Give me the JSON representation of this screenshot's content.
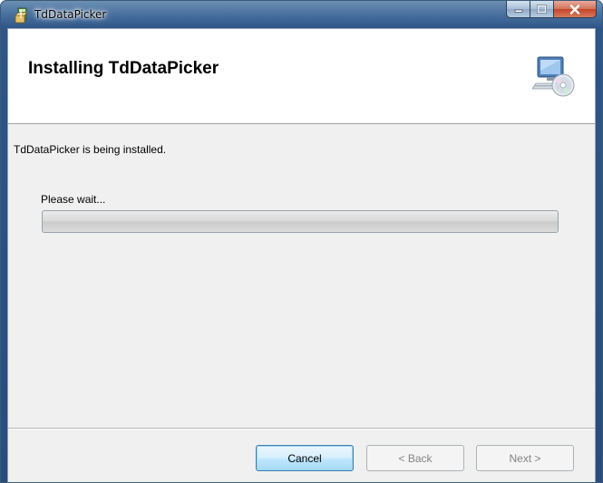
{
  "window": {
    "title": "TdDataPicker",
    "icon": "installer-icon",
    "controls": [
      "minimize-icon",
      "maximize-icon",
      "close-icon"
    ]
  },
  "banner": {
    "title": "Installing TdDataPicker",
    "icon": "computer-cd-icon"
  },
  "main": {
    "status": "TdDataPicker is being installed.",
    "progress_label": "Please wait...",
    "progress": 0.0
  },
  "buttons": {
    "cancel": "Cancel",
    "back": "< Back",
    "next": "Next >"
  },
  "colors": {
    "titlebar": "#2f5687",
    "client": "#f0f0f0",
    "close_button": "#c4442a"
  }
}
